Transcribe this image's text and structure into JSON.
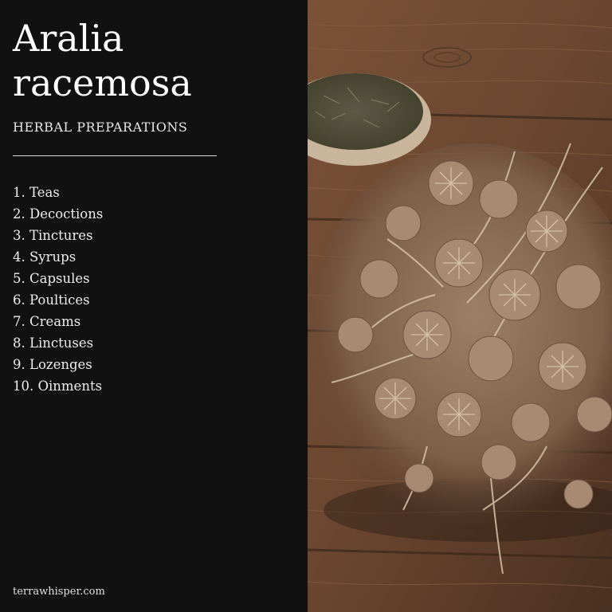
{
  "title": {
    "line1": "Aralia",
    "line2": "racemosa"
  },
  "subtitle": "HERBAL PREPARATIONS",
  "preparations": [
    "1. Teas",
    "2. Decoctions",
    "3. Tinctures",
    "4. Syrups",
    "5. Capsules",
    "6. Poultices",
    "7. Creams",
    "8. Linctuses",
    "9. Lozenges",
    "10. Oinments"
  ],
  "footer": "terrawhisper.com",
  "photo": {
    "subject": "dried herb on wooden table with bowl of dried leaves"
  },
  "colors": {
    "panel_background": "#111111",
    "text": "#f2f2f2",
    "wood": "#6b4a33",
    "herb": "#b89a80"
  }
}
